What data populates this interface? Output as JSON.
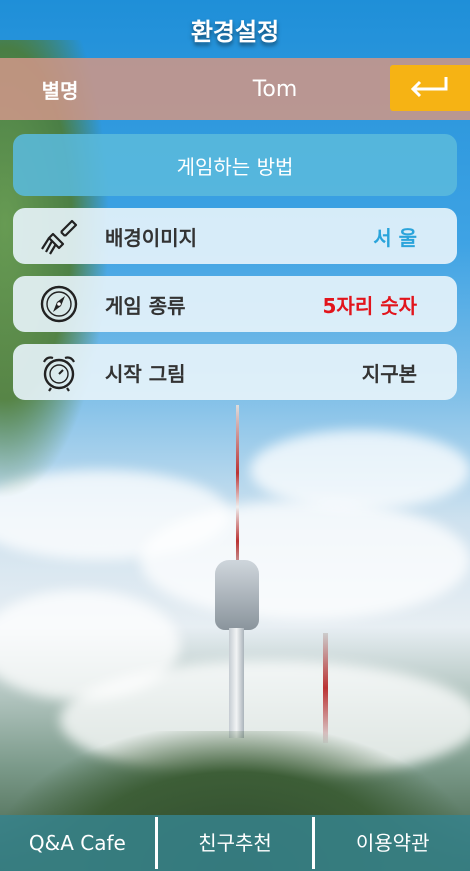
{
  "header": {
    "title": "환경설정"
  },
  "nickname": {
    "label": "별명",
    "value": "Tom",
    "back_icon": "return-arrow-icon"
  },
  "how_to_play": {
    "label": "게임하는 방법"
  },
  "settings": [
    {
      "label": "배경이미지",
      "value": "서 울",
      "value_color": "#2aa4db",
      "icon": "paint-brush-icon"
    },
    {
      "label": "게임 종류",
      "value": "5자리 숫자",
      "value_color": "#e2141c",
      "icon": "compass-icon"
    },
    {
      "label": "시작 그림",
      "value": "지구본",
      "value_color": "#333333",
      "icon": "alarm-clock-icon"
    }
  ],
  "footer": {
    "items": [
      "Q&A Cafe",
      "친구추천",
      "이용약관"
    ]
  }
}
